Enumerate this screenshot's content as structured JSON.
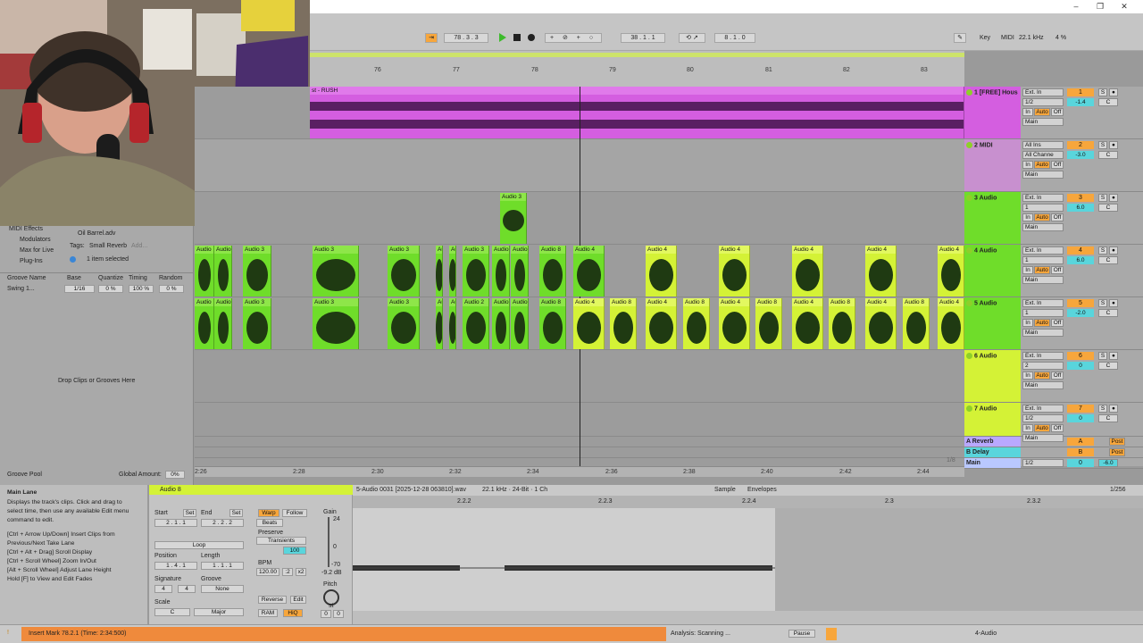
{
  "colors": {
    "purple": "#d45ee0",
    "green": "#6fdd2a",
    "lime": "#d4f236",
    "cyan": "#59d5dc",
    "orange": "#f7a63c",
    "status_orange": "#ef8a3c"
  },
  "transport": {
    "position": "78 . 3 . 3",
    "loop_start": "38 . 1 . 1",
    "loop_length": "8 . 1 . 0",
    "key_label": "Key",
    "midi_label": "MIDI",
    "sample_rate": "22.1 kHz",
    "cpu": "4 %"
  },
  "ruler": {
    "bars": [
      "76",
      "77",
      "78",
      "79",
      "80",
      "81",
      "82",
      "83"
    ],
    "set_label": "Set"
  },
  "browser": {
    "items": [
      "MIDI Effects",
      "Modulators",
      "Max for Live",
      "Plug-Ins"
    ],
    "file_name": "Oil Barrel.adv",
    "tags_label": "Tags:",
    "tag_value": "Small Reverb",
    "tag_add": "Add...",
    "selected_info": "1 item selected",
    "groove_headers": [
      "Groove Name",
      "Base",
      "Quantize",
      "Timing",
      "Random"
    ],
    "groove_row": {
      "name": "Swing 1...",
      "base": "1/16",
      "quantize": "0 %",
      "timing": "100 %",
      "random": "0 %"
    },
    "drop_hint": "Drop Clips or Grooves Here",
    "groove_pool_label": "Groove Pool",
    "global_amount_label": "Global Amount:",
    "global_amount_value": "0%"
  },
  "arrangement": {
    "track1_clip_title": "st - RUSH",
    "track3_clip": "Audio 3",
    "clip_labels": [
      "Audio",
      "Audio 3",
      "Audio 2",
      "Audio 8",
      "Audio 4"
    ],
    "zoom_label": "1/8"
  },
  "tracks": [
    {
      "name": "1 [FREE] Hous",
      "input": "Ext. In",
      "channel": "1/2",
      "number": "1",
      "volume": "-1.4",
      "pan": "C",
      "output": "Main"
    },
    {
      "name": "2 MIDI",
      "input": "All Ins",
      "channel": "All Channe",
      "number": "2",
      "volume": "-3.0",
      "pan": "C",
      "output": "Main"
    },
    {
      "name": "3 Audio",
      "input": "Ext. In",
      "channel": "1",
      "number": "3",
      "volume": "6.0",
      "pan": "C",
      "output": "Main"
    },
    {
      "name": "4 Audio",
      "input": "Ext. In",
      "channel": "1",
      "number": "4",
      "volume": "6.0",
      "pan": "C",
      "output": "Main"
    },
    {
      "name": "5 Audio",
      "input": "Ext. In",
      "channel": "1",
      "number": "5",
      "volume": "-2.0",
      "pan": "C",
      "output": "Main"
    },
    {
      "name": "6 Audio",
      "input": "Ext. In",
      "channel": "2",
      "number": "6",
      "volume": "0",
      "pan": "C",
      "output": "Main"
    },
    {
      "name": "7 Audio",
      "input": "Ext. In",
      "channel": "1/2",
      "number": "7",
      "volume": "0",
      "pan": "C",
      "output": "Main"
    }
  ],
  "returns": [
    {
      "name": "A Reverb",
      "letter": "A",
      "post": "Post"
    },
    {
      "name": "B Delay",
      "letter": "B",
      "post": "Post"
    },
    {
      "name": "Main",
      "channel": "1/2",
      "number": "0",
      "volume": "-6.0"
    }
  ],
  "monitor": {
    "in": "In",
    "auto": "Auto",
    "off": "Off",
    "solo": "S"
  },
  "timeline": {
    "times": [
      "2:26",
      "2:28",
      "2:30",
      "2:32",
      "2:34",
      "2:36",
      "2:38",
      "2:40",
      "2:42",
      "2:44"
    ]
  },
  "info": {
    "title": "Main Lane",
    "lines": [
      "Displays the track's clips. Click and drag to",
      "select time, then use any available Edit menu",
      "command to edit.",
      "",
      "[Ctrl + Arrow Up/Down] Insert Clips from",
      "Previous/Next Take Lane",
      "[Ctrl + Alt + Drag] Scroll Display",
      "[Ctrl + Scroll Wheel] Zoom In/Out",
      "[Alt + Scroll Wheel] Adjust Lane Height",
      "Hold [F] to View and Edit Fades"
    ]
  },
  "clip": {
    "name": "Audio 8",
    "start_label": "Start",
    "set": "Set",
    "end_label": "End",
    "start": "2 . 1 . 1",
    "end": "2 . 2 . 2",
    "loop": "Loop",
    "position_label": "Position",
    "length_label": "Length",
    "position": "1 . 4 . 1",
    "length": "1 . 1 . 1",
    "signature_label": "Signature",
    "groove_label": "Groove",
    "sig_num": "4",
    "sig_den": "4",
    "groove": "None",
    "scale_label": "Scale",
    "scale_root": "C",
    "scale_mode": "Major",
    "warp": "Warp",
    "follow": "Follow",
    "beats": "Beats",
    "preserve_label": "Preserve",
    "preserve": "Transients",
    "bpm_label": "BPM",
    "bpm": "120.00",
    "half": ":2",
    "double": "x2",
    "reverse": "Reverse",
    "edit": "Edit",
    "ram": "RAM",
    "hiq": "HiQ",
    "gain_label": "Gain",
    "gain": "-9.2 dB",
    "gain_top": "24",
    "gain_mid": "0",
    "gain_bot": "-70",
    "pitch_label": "Pitch",
    "pitch_unit": "st",
    "pitch": "0",
    "detune": "0",
    "warp_value": "100"
  },
  "sample": {
    "file": "5-Audio 0031 [2025-12-28 063810].wav",
    "details": "22.1 kHz · 24-Bit · 1 Ch",
    "tab_sample": "Sample",
    "tab_envelopes": "Envelopes",
    "zoom": "1/256",
    "markers": [
      "2.2.2",
      "2.2.3",
      "2.2.4",
      "2.3",
      "2.3.2"
    ]
  },
  "status": {
    "message": "Insert Mark 78.2.1 (Time: 2:34:500)",
    "analysis": "Analysis: Scanning ...",
    "pause": "Pause",
    "track": "4-Audio"
  }
}
